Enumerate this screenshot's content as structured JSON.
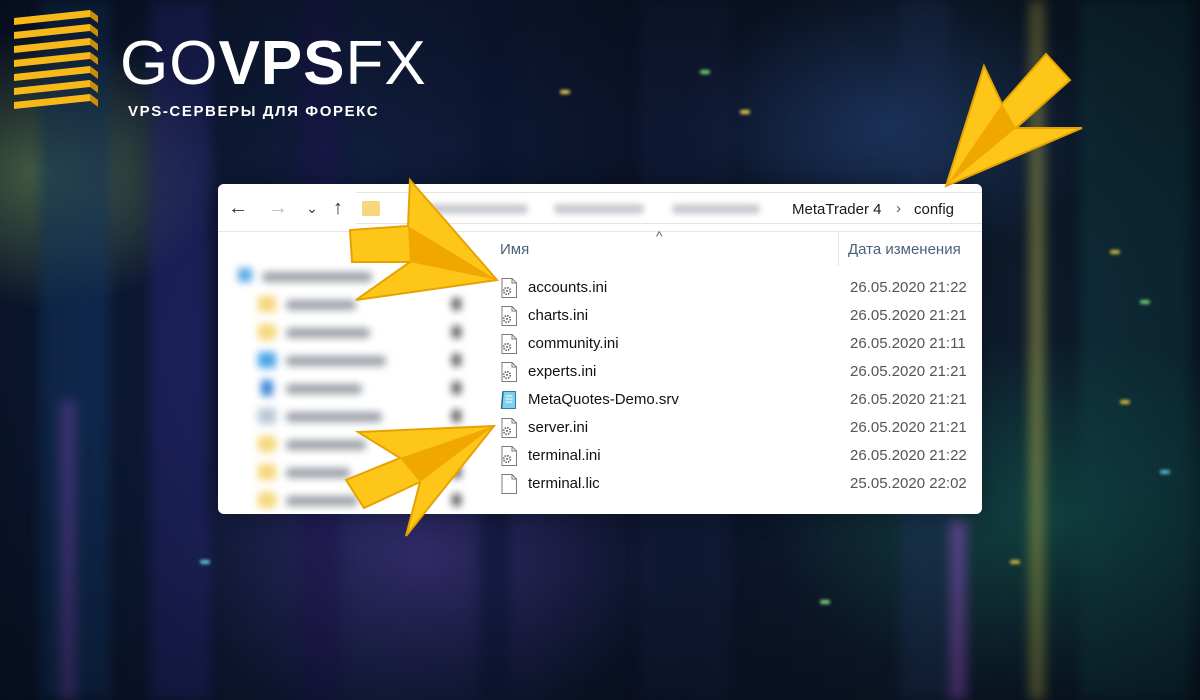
{
  "brand": {
    "name_light_1": "GO",
    "name_bold": "VPS",
    "name_light_2": "FX",
    "tagline": "VPS-СЕРВЕРЫ ДЛЯ ФОРЕКС",
    "accent": "#f7b81a"
  },
  "explorer": {
    "breadcrumb": [
      "MetaTrader 4",
      "config"
    ],
    "breadcrumb_separator": "›",
    "nav_buttons": {
      "back": "←",
      "forward": "→",
      "recent": "⌄",
      "up": "↑"
    },
    "columns": {
      "name": "Имя",
      "date_modified": "Дата изменения",
      "sort_indicator": "^"
    },
    "files": [
      {
        "name": "accounts.ini",
        "date": "26.05.2020 21:22",
        "icon": "ini-settings-file-icon"
      },
      {
        "name": "charts.ini",
        "date": "26.05.2020 21:21",
        "icon": "ini-settings-file-icon"
      },
      {
        "name": "community.ini",
        "date": "26.05.2020 21:11",
        "icon": "ini-settings-file-icon"
      },
      {
        "name": "experts.ini",
        "date": "26.05.2020 21:21",
        "icon": "ini-settings-file-icon"
      },
      {
        "name": "MetaQuotes-Demo.srv",
        "date": "26.05.2020 21:21",
        "icon": "srv-file-icon"
      },
      {
        "name": "server.ini",
        "date": "26.05.2020 21:21",
        "icon": "ini-settings-file-icon"
      },
      {
        "name": "terminal.ini",
        "date": "26.05.2020 21:22",
        "icon": "ini-settings-file-icon"
      },
      {
        "name": "terminal.lic",
        "date": "25.05.2020 22:02",
        "icon": "blank-file-icon"
      }
    ]
  },
  "annotations": {
    "arrow_color": "#ffc61a",
    "highlighted": [
      "config",
      "accounts.ini",
      "server.ini"
    ]
  }
}
